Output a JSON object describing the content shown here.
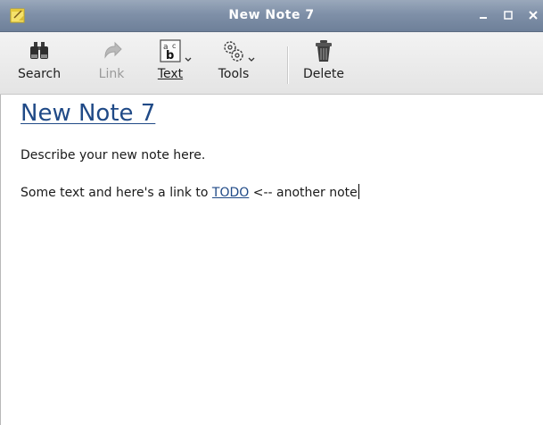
{
  "window": {
    "title": "New Note 7",
    "icons": {
      "app": "note-app-icon",
      "minimize": "minimize-icon",
      "maximize": "maximize-icon",
      "close": "close-icon"
    }
  },
  "toolbar": {
    "search_label": "Search",
    "link_label": "Link",
    "text_label": "Text",
    "tools_label": "Tools",
    "delete_label": "Delete",
    "icons": {
      "search": "binoculars-icon",
      "link": "link-arrow-icon",
      "text": "text-format-icon",
      "tools": "gears-icon",
      "delete": "trash-can-icon"
    }
  },
  "note": {
    "title": "New Note 7",
    "description": "Describe your new note here.",
    "line2_before": "Some text and here's a link to ",
    "line2_link": "TODO",
    "line2_after": " <-- another note"
  },
  "colors": {
    "titlebar": "#7f90a8",
    "link": "#204a87",
    "text": "#1a1a1a"
  }
}
